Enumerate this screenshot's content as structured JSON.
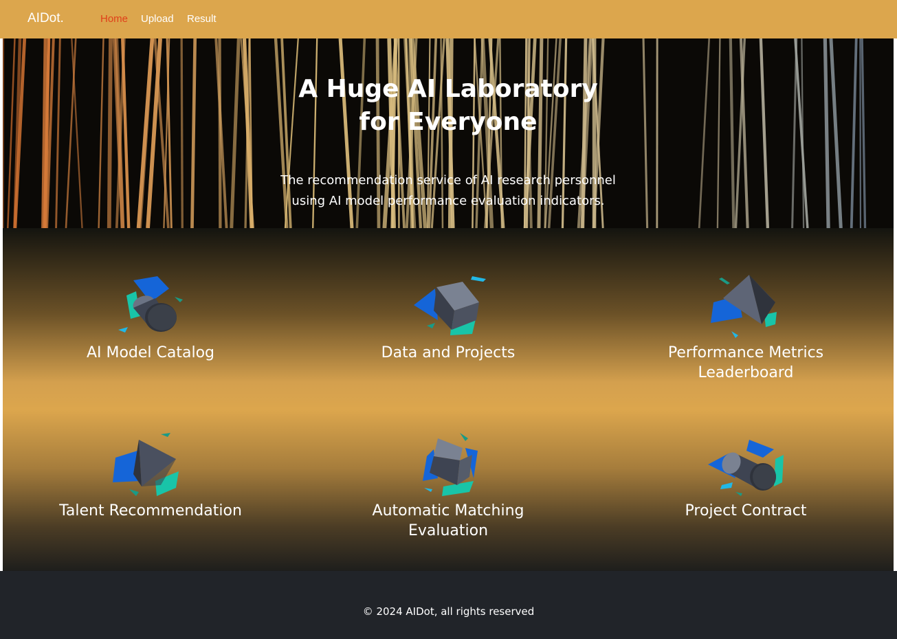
{
  "navbar": {
    "brand": "AIDot.",
    "links": [
      {
        "label": "Home",
        "active": true
      },
      {
        "label": "Upload",
        "active": false
      },
      {
        "label": "Result",
        "active": false
      }
    ],
    "background": "#dca64d",
    "active_color": "#e0401a"
  },
  "hero": {
    "title_line1": "A Huge AI Laboratory",
    "title_line2": "for Everyone",
    "subtitle_line1": "The recommendation service of AI research personnel",
    "subtitle_line2": "using AI model performance evaluation indicators."
  },
  "features": [
    {
      "icon": "cylinder-icon",
      "line1": "AI Model Catalog",
      "line2": ""
    },
    {
      "icon": "cube-icon",
      "line1": "Data and Projects",
      "line2": ""
    },
    {
      "icon": "pyramid-icon",
      "line1": "Performance Metrics",
      "line2": "Leaderboard"
    },
    {
      "icon": "pyramid-icon",
      "line1": "Talent Recommendation",
      "line2": ""
    },
    {
      "icon": "cube-icon",
      "line1": "Automatic Matching",
      "line2": "Evaluation"
    },
    {
      "icon": "cylinder-icon",
      "line1": "Project Contract",
      "line2": ""
    }
  ],
  "footer": {
    "copyright": "© 2024 AIDot, all rights reserved",
    "background": "#212429"
  }
}
